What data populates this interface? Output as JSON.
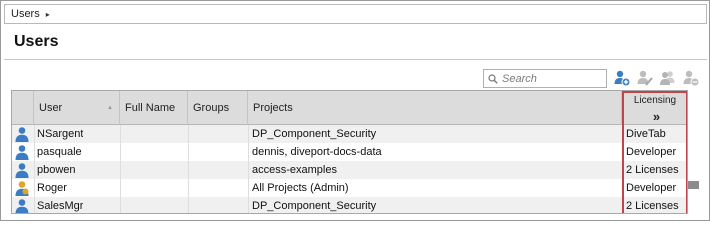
{
  "breadcrumb": {
    "item": "Users",
    "separator": "▸"
  },
  "page": {
    "title": "Users"
  },
  "search": {
    "placeholder": "Search"
  },
  "toolbar": {
    "icons": [
      "add-user-icon",
      "edit-user-icon",
      "user-group-icon",
      "remove-user-icon"
    ]
  },
  "grid": {
    "columns": {
      "icon": "",
      "user": "User",
      "full_name": "Full Name",
      "groups": "Groups",
      "projects": "Projects",
      "licensing": "Licensing",
      "licensing_expand": "»"
    },
    "rows": [
      {
        "icon": "user-icon",
        "user": "NSargent",
        "full_name": "",
        "groups": "",
        "projects": "DP_Component_Security",
        "licensing": "DiveTab"
      },
      {
        "icon": "user-icon",
        "user": "pasquale",
        "full_name": "",
        "groups": "",
        "projects": "dennis, diveport-docs-data",
        "licensing": "Developer"
      },
      {
        "icon": "user-icon",
        "user": "pbowen",
        "full_name": "",
        "groups": "",
        "projects": "access-examples",
        "licensing": "2 Licenses"
      },
      {
        "icon": "admin-user-icon",
        "user": "Roger",
        "full_name": "",
        "groups": "",
        "projects": "All Projects (Admin)",
        "licensing": "Developer"
      },
      {
        "icon": "user-icon",
        "user": "SalesMgr",
        "full_name": "",
        "groups": "",
        "projects": "DP_Component_Security",
        "licensing": "2 Licenses"
      }
    ]
  },
  "colors": {
    "licensing_highlight": "#c0444a",
    "header_bg": "#dcdcdc",
    "row_alt_bg": "#f0f0f0",
    "user_icon_blue": "#3b7dc4",
    "admin_icon_gold": "#e0a62a"
  }
}
